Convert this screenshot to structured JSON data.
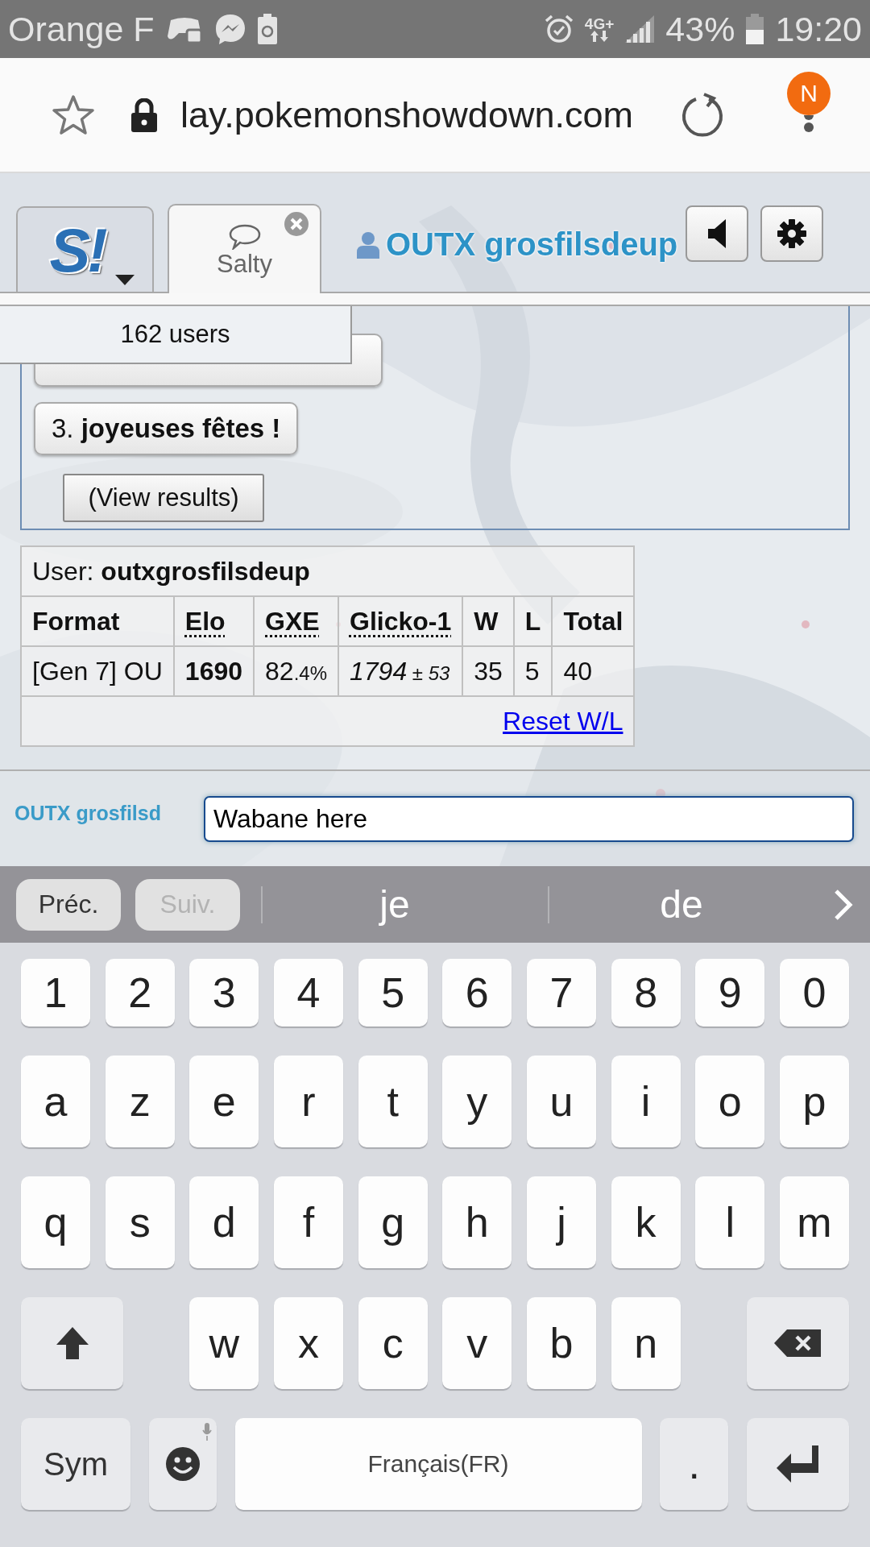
{
  "status_bar": {
    "carrier": "Orange F",
    "network": "4G+",
    "battery": "43%",
    "time": "19:20"
  },
  "browser": {
    "url": "lay.pokemonshowdown.com",
    "account_initial": "N"
  },
  "header": {
    "tabs": [
      {
        "kind": "home",
        "label": "S!",
        "selected": false
      },
      {
        "kind": "room",
        "label": "Salty",
        "selected": true
      }
    ],
    "username": "OUTX grosfilsdeup"
  },
  "users_popup": "162 users",
  "poll": {
    "options": [
      {
        "covered": true
      },
      {
        "covered": false,
        "label": "3. **joyeuses fêtes !**"
      }
    ],
    "view_results": "(View results)"
  },
  "ladder": {
    "user": "User: **outxgrosfilsdeup**",
    "columns": [
      {
        "label": "Format",
        "abbr": false
      },
      {
        "label": "Elo",
        "abbr": true
      },
      {
        "label": "GXE",
        "abbr": true
      },
      {
        "label": "Glicko-1",
        "abbr": true
      },
      {
        "label": "W",
        "abbr": false
      },
      {
        "label": "L",
        "abbr": false
      },
      {
        "label": "Total",
        "abbr": false
      }
    ],
    "rows": [
      {
        "cells": [
          {
            "text": "[Gen 7] OU",
            "bold": false,
            "italic": false
          },
          {
            "text": "1690",
            "bold": true,
            "italic": false
          },
          {
            "text": "82",
            "minor": ".4%",
            "bold": false,
            "italic": false
          },
          {
            "text": "1794",
            "minor": " ± 53",
            "bold": false,
            "italic": true
          },
          {
            "text": "35",
            "bold": false,
            "italic": false
          },
          {
            "text": "5",
            "bold": false,
            "italic": false
          },
          {
            "text": "40",
            "bold": false,
            "italic": false
          }
        ]
      }
    ],
    "reset_link": "Reset W/L"
  },
  "chat": {
    "name": "OUTX grosfilsd",
    "value": "Wabane here"
  },
  "suggestions": {
    "prev": {
      "label": "Préc.",
      "disabled": false
    },
    "next": {
      "label": "Suiv.",
      "disabled": true
    },
    "words": [
      "je",
      "de"
    ]
  },
  "keyboard": {
    "rows": [
      [
        {
          "kind": "key",
          "label": "1"
        },
        {
          "kind": "key",
          "label": "2"
        },
        {
          "kind": "key",
          "label": "3"
        },
        {
          "kind": "key",
          "label": "4"
        },
        {
          "kind": "key",
          "label": "5"
        },
        {
          "kind": "key",
          "label": "6"
        },
        {
          "kind": "key",
          "label": "7"
        },
        {
          "kind": "key",
          "label": "8"
        },
        {
          "kind": "key",
          "label": "9"
        },
        {
          "kind": "key",
          "label": "0"
        }
      ],
      [
        {
          "kind": "key",
          "label": "a"
        },
        {
          "kind": "key",
          "label": "z"
        },
        {
          "kind": "key",
          "label": "e"
        },
        {
          "kind": "key",
          "label": "r"
        },
        {
          "kind": "key",
          "label": "t"
        },
        {
          "kind": "key",
          "label": "y"
        },
        {
          "kind": "key",
          "label": "u"
        },
        {
          "kind": "key",
          "label": "i"
        },
        {
          "kind": "key",
          "label": "o"
        },
        {
          "kind": "key",
          "label": "p"
        }
      ],
      [
        {
          "kind": "key",
          "label": "q"
        },
        {
          "kind": "key",
          "label": "s"
        },
        {
          "kind": "key",
          "label": "d"
        },
        {
          "kind": "key",
          "label": "f"
        },
        {
          "kind": "key",
          "label": "g"
        },
        {
          "kind": "key",
          "label": "h"
        },
        {
          "kind": "key",
          "label": "j"
        },
        {
          "kind": "key",
          "label": "k"
        },
        {
          "kind": "key",
          "label": "l"
        },
        {
          "kind": "key",
          "label": "m"
        }
      ],
      [
        {
          "kind": "shift"
        },
        "",
        {
          "kind": "key",
          "label": "w"
        },
        {
          "kind": "key",
          "label": "x"
        },
        {
          "kind": "key",
          "label": "c"
        },
        {
          "kind": "key",
          "label": "v"
        },
        {
          "kind": "key",
          "label": "b"
        },
        {
          "kind": "key",
          "label": "n"
        },
        "",
        {
          "kind": "backspace"
        }
      ]
    ],
    "bottom_bar": [
      {
        "kind": "sym",
        "label": "Sym"
      },
      {
        "kind": "emoji"
      },
      {
        "kind": "space",
        "label": "Français(FR)"
      },
      {
        "kind": "punct",
        "label": "."
      },
      {
        "kind": "enter"
      }
    ]
  }
}
